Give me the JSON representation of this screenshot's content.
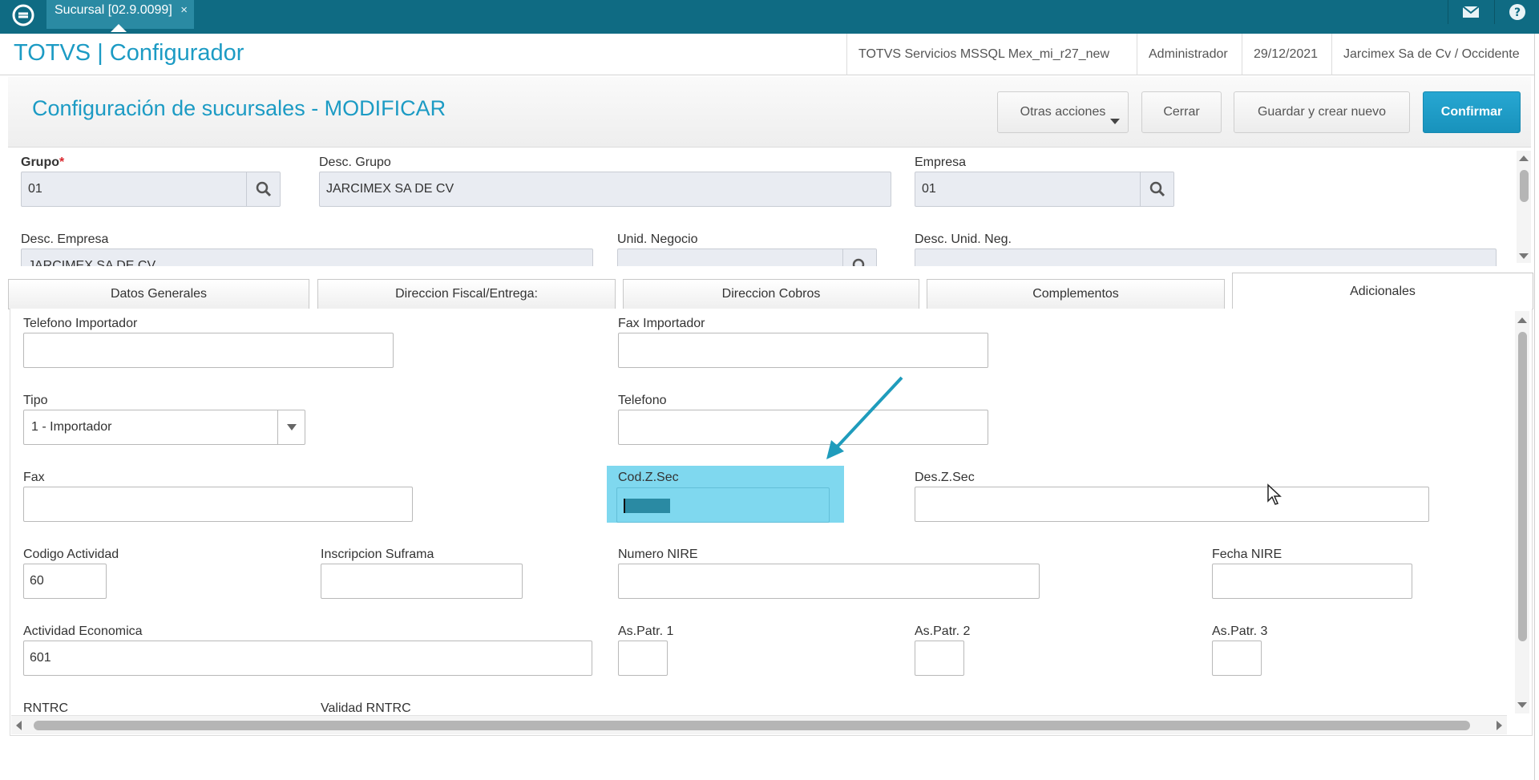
{
  "colors": {
    "topbar": "#0f6b83",
    "accent": "#1c9bc4",
    "primary_button": "#1892bc",
    "highlight": "#7fd8ef",
    "annotation_arrow": "#1f9cbc",
    "required": "#d9262c"
  },
  "topbar": {
    "tab_label": "Sucursal [02.9.0099]",
    "tab_close": "×",
    "icons": [
      "totvs-logo-icon",
      "mail-icon",
      "help-icon"
    ]
  },
  "header": {
    "brand": "TOTVS | Configurador",
    "environment": "TOTVS Servicios MSSQL Mex_mi_r27_new",
    "user": "Administrador",
    "date": "29/12/2021",
    "company": "Jarcimex Sa de Cv / Occidente"
  },
  "titlebar": {
    "title": "Configuración de sucursales - MODIFICAR",
    "buttons": {
      "other_actions": "Otras acciones",
      "close": "Cerrar",
      "save_new": "Guardar y crear nuevo",
      "confirm": "Confirmar"
    }
  },
  "upper_form": {
    "grupo": {
      "label": "Grupo",
      "required_mark": "*",
      "value": "01"
    },
    "desc_grupo": {
      "label": "Desc. Grupo",
      "value": "JARCIMEX SA DE CV"
    },
    "empresa": {
      "label": "Empresa",
      "value": "01"
    },
    "desc_empresa": {
      "label": "Desc. Empresa",
      "value": "JARCIMEX SA DE CV"
    },
    "unid_negocio": {
      "label": "Unid. Negocio",
      "value": ""
    },
    "desc_unid_neg": {
      "label": "Desc. Unid. Neg.",
      "value": ""
    }
  },
  "tabs": [
    {
      "label": "Datos Generales"
    },
    {
      "label": "Direccion Fiscal/Entrega:"
    },
    {
      "label": "Direccion Cobros"
    },
    {
      "label": "Complementos"
    },
    {
      "label": "Adicionales",
      "active": true
    }
  ],
  "adicionales": {
    "telefono_importador": {
      "label": "Telefono Importador",
      "value": ""
    },
    "fax_importador": {
      "label": "Fax Importador",
      "value": ""
    },
    "tipo": {
      "label": "Tipo",
      "value": "1 - Importador"
    },
    "telefono": {
      "label": "Telefono",
      "value": ""
    },
    "fax": {
      "label": "Fax",
      "value": ""
    },
    "cod_z_sec": {
      "label": "Cod.Z.Sec",
      "value": ""
    },
    "des_z_sec": {
      "label": "Des.Z.Sec",
      "value": ""
    },
    "codigo_actividad": {
      "label": "Codigo Actividad",
      "value": "60"
    },
    "inscripcion_suframa": {
      "label": "Inscripcion Suframa",
      "value": ""
    },
    "numero_nire": {
      "label": "Numero NIRE",
      "value": ""
    },
    "fecha_nire": {
      "label": "Fecha NIRE",
      "value": "  /  /"
    },
    "actividad_economica": {
      "label": "Actividad Economica",
      "value": "601"
    },
    "as_patr_1": {
      "label": "As.Patr. 1",
      "value": ""
    },
    "as_patr_2": {
      "label": "As.Patr. 2",
      "value": ""
    },
    "as_patr_3": {
      "label": "As.Patr. 3",
      "value": ""
    },
    "rntrc": {
      "label": "RNTRC"
    },
    "validad_rntrc": {
      "label": "Validad RNTRC"
    }
  }
}
